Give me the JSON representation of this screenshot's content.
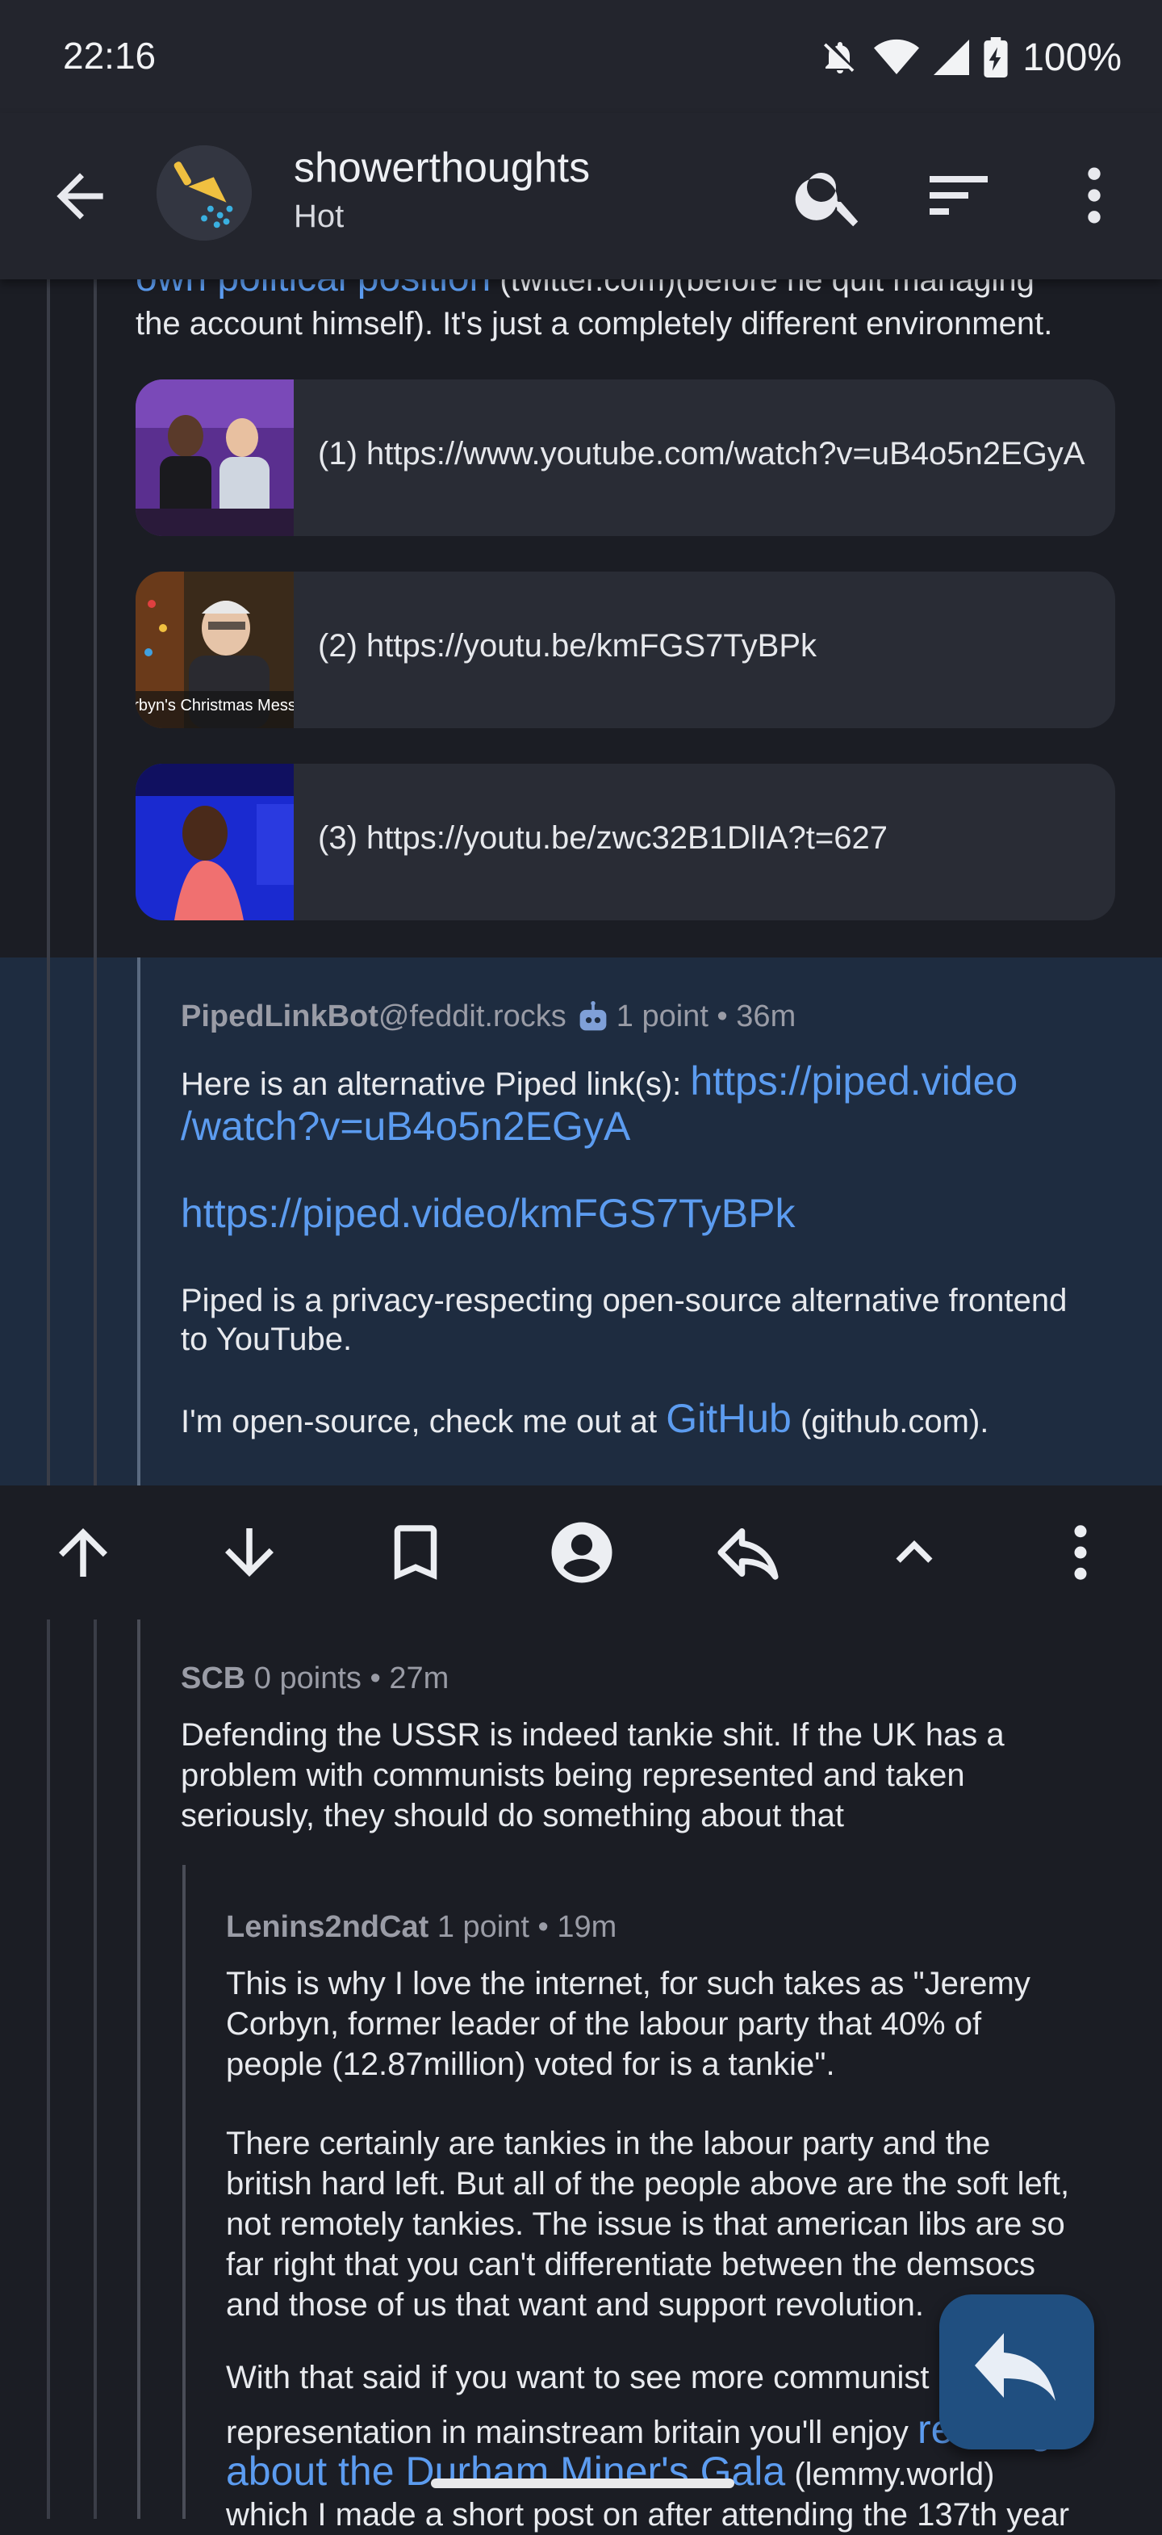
{
  "status_bar": {
    "time": "22:16",
    "battery": "100%",
    "icons": [
      "mute-icon",
      "wifi-icon",
      "signal-icon",
      "battery-charging-icon"
    ]
  },
  "app_bar": {
    "community": "showerthoughts",
    "sort": "Hot",
    "icons": [
      "back-arrow-icon",
      "search-icon",
      "sort-icon",
      "more-vert-icon"
    ]
  },
  "top_comment": {
    "link_partial": "own political position",
    "line1_rest": " (twitter.com)(before he quit managing",
    "line2": "the account himself). It's just a completely different environment.",
    "embeds": [
      {
        "text": "(1) https://www.youtube.com/watch?v=uB4o5n2EGyA"
      },
      {
        "text": "(2) https://youtu.be/kmFGS7TyBPk",
        "thumb_caption": "rbyn's Christmas Mess"
      },
      {
        "text": "(3) https://youtu.be/zwc32B1DlIA?t=627"
      }
    ]
  },
  "bot_comment": {
    "author": "PipedLinkBot",
    "instance": "@feddit.rocks",
    "points": "1 point",
    "age": "36m",
    "intro": "Here is an alternative Piped link(s): ",
    "link1_a": "https://piped.video",
    "link1_b": "/watch?v=uB4o5n2EGyA",
    "link2": "https://piped.video/kmFGS7TyBPk",
    "para_a": "Piped is a privacy-respecting open-source alternative frontend",
    "para_b": "to YouTube.",
    "oss_text": "I'm open-source, check me out at ",
    "oss_link": "GitHub",
    "oss_tail": " (github.com)."
  },
  "action_bar": {
    "icons": [
      "upvote-icon",
      "downvote-icon",
      "bookmark-icon",
      "profile-icon",
      "reply-icon",
      "collapse-icon",
      "more-vert-icon"
    ]
  },
  "comment_scb": {
    "author": "SCB",
    "points": "0 points",
    "age": "27m",
    "lines": [
      "Defending the USSR is indeed tankie shit. If the UK has a",
      "problem with communists being represented and taken",
      "seriously, they should do something about that"
    ]
  },
  "comment_lenins": {
    "author": "Lenins2ndCat",
    "points": "1 point",
    "age": "19m",
    "para1": [
      "This is why I love the internet, for such takes as \"Jeremy",
      "Corbyn, former leader of the labour party that 40% of",
      "people (12.87million) voted for is a tankie\"."
    ],
    "para2": [
      "There certainly are tankies in the labour party and the",
      "british hard left. But all of the people above are the soft left,",
      "not remotely tankies. The issue is that american libs are so",
      "far right that you can't differentiate between the demsocs",
      "and those of us that want and support revolution."
    ],
    "para3_line1": "With that said if you want to see more communist",
    "para3_line2_a": "representation in mainstream britain you'll enjoy ",
    "para3_line2_link": "reading",
    "para3_line3_link": "about the Durham Miner's Gala",
    "para3_line3_tail": " (lemmy.world)",
    "para3_line4": "which I made a short post on after attending the 137th year"
  }
}
